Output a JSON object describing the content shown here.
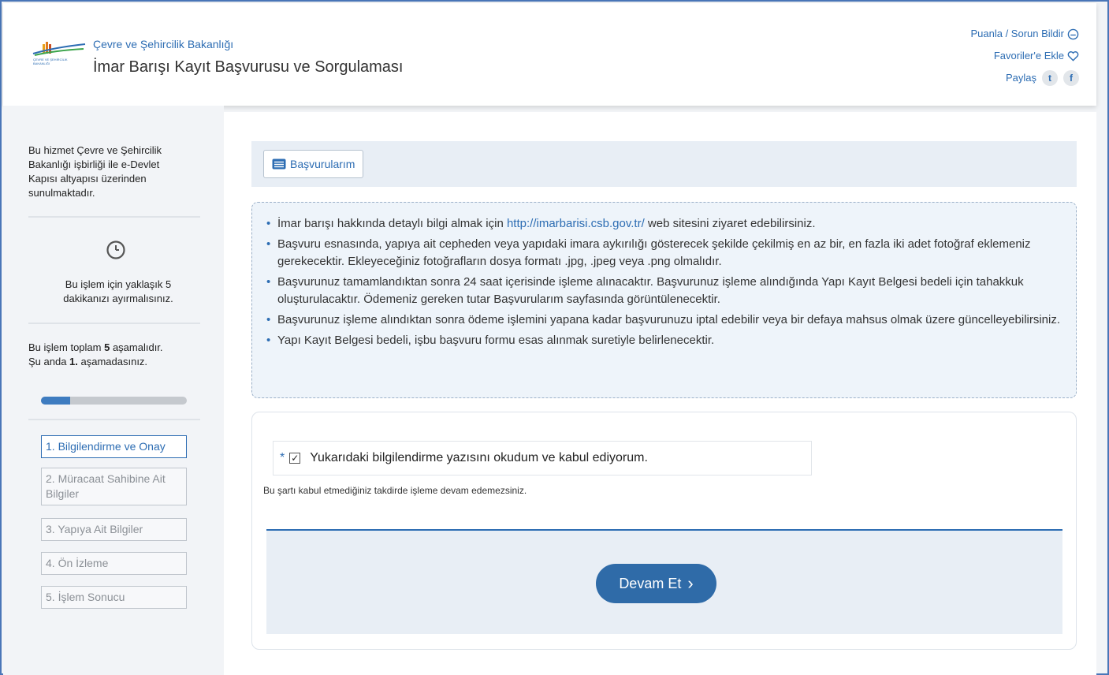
{
  "header": {
    "ministry": "Çevre ve Şehircilik Bakanlığı",
    "title": "İmar Barışı Kayıt Başvurusu ve Sorgulaması",
    "links": {
      "rate": "Puanla / Sorun Bildir",
      "favorite": "Favoriler'e Ekle",
      "share": "Paylaş"
    },
    "icons": {
      "rate": "chat-icon",
      "favorite": "heart-icon",
      "twitter": "twitter-icon",
      "facebook": "facebook-icon"
    }
  },
  "sidebar": {
    "intro": "Bu hizmet Çevre ve Şehircilik Bakanlığı işbirliği ile e-Devlet Kapısı altyapısı üzerinden sunulmaktadır.",
    "time_note": "Bu işlem için yaklaşık 5 dakikanızı ayırmalısınız.",
    "total_steps_prefix": "Bu işlem toplam ",
    "total_steps": "5",
    "total_steps_suffix": " aşamalıdır.",
    "current_prefix": "Şu anda ",
    "current_step": "1.",
    "current_suffix": " aşamadasınız.",
    "progress": 0.2,
    "steps": [
      "1. Bilgilendirme ve Onay",
      "2. Müracaat Sahibine Ait Bilgiler",
      "3. Yapıya Ait Bilgiler",
      "4. Ön İzleme",
      "5. İşlem Sonucu"
    ]
  },
  "toolbar": {
    "applications_label": "Başvurularım"
  },
  "info": {
    "item1_prefix": "İmar barışı hakkında detaylı bilgi almak için ",
    "item1_link": "http://imarbarisi.csb.gov.tr/",
    "item1_suffix": " web sitesini ziyaret edebilirsiniz.",
    "item2": "Başvuru esnasında, yapıya ait cepheden veya yapıdaki imara aykırılığı gösterecek şekilde çekilmiş en az bir, en fazla iki adet fotoğraf eklemeniz gerekecektir. Ekleyeceğiniz fotoğrafların dosya formatı .jpg, .jpeg veya .png olmalıdır.",
    "item3": "Başvurunuz tamamlandıktan sonra 24 saat içerisinde işleme alınacaktır. Başvurunuz işleme alındığında Yapı Kayıt Belgesi bedeli için tahakkuk oluşturulacaktır. Ödemeniz gereken tutar Başvurularım sayfasında görüntülenecektir.",
    "item4": "Başvurunuz işleme alındıktan sonra ödeme işlemini yapana kadar başvurunuzu iptal edebilir veya bir defaya mahsus olmak üzere güncelleyebilirsiniz.",
    "item5": "Yapı Kayıt Belgesi bedeli, işbu başvuru formu esas alınmak suretiyle belirlenecektir."
  },
  "form": {
    "required_mark": "*",
    "consent_label": "Yukarıdaki bilgilendirme yazısını okudum ve kabul ediyorum.",
    "consent_checked": true,
    "warning": "Bu şartı kabul etmediğiniz takdirde işleme devam edemezsiniz.",
    "continue_label": "Devam Et"
  }
}
